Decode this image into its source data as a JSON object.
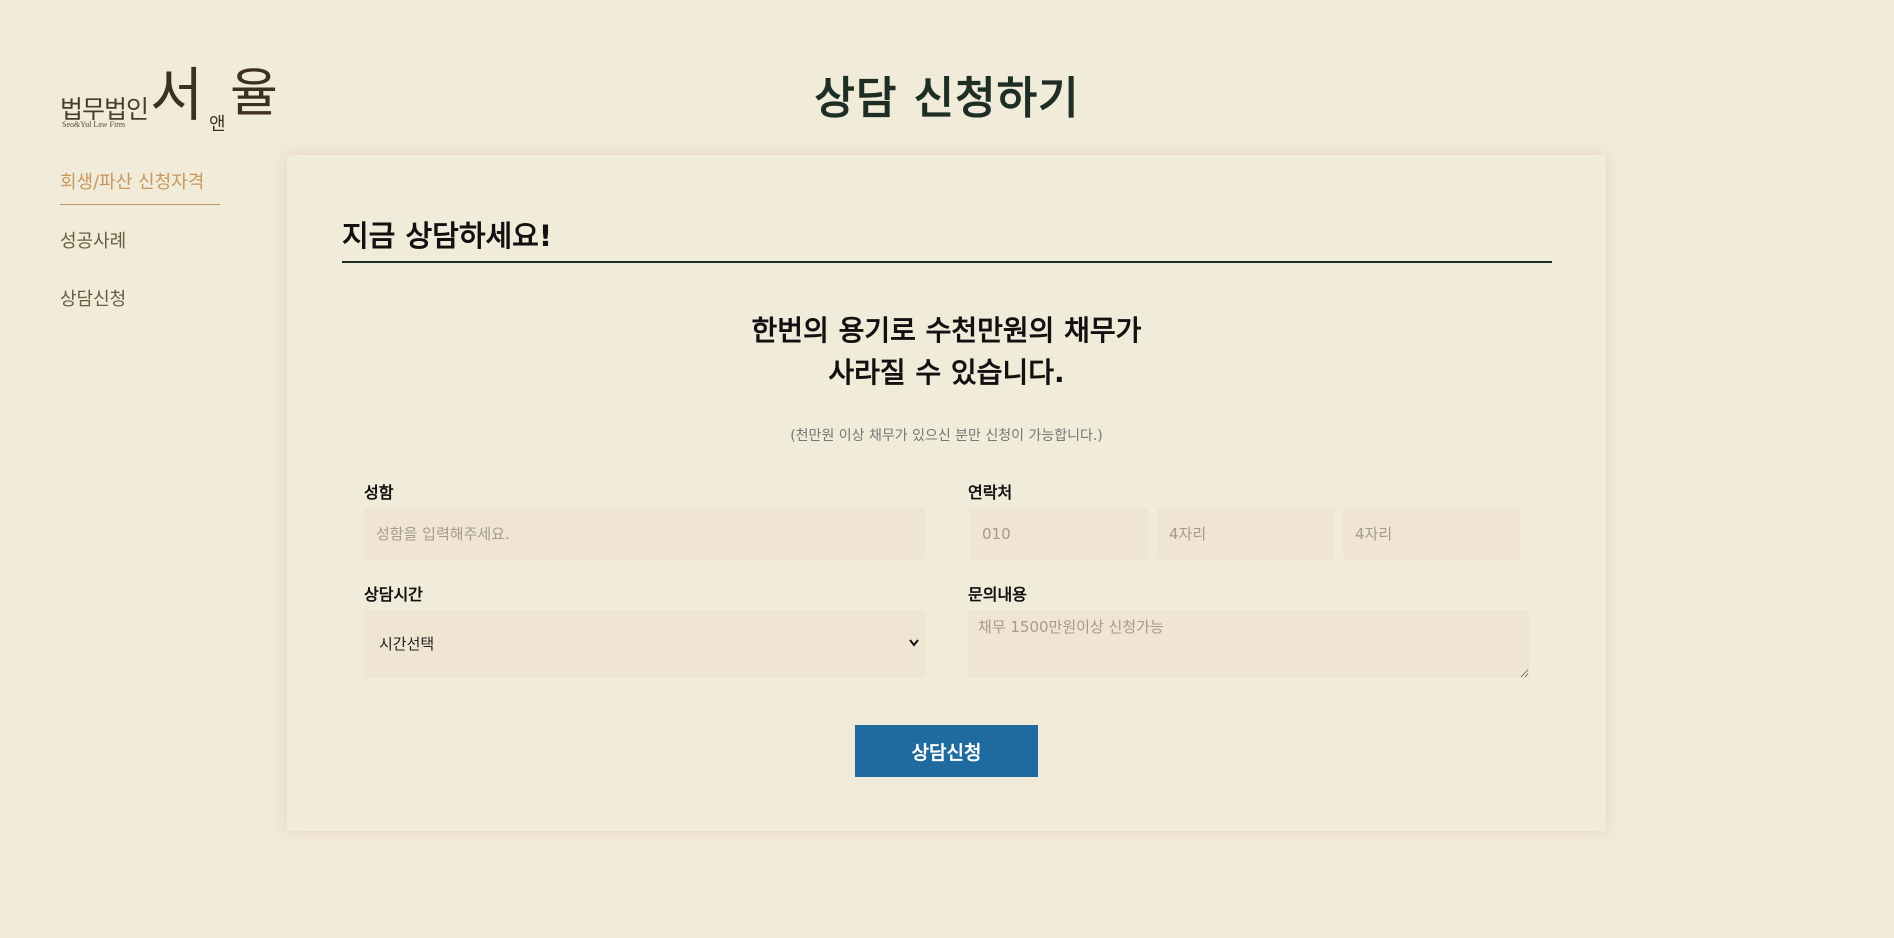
{
  "logo": {
    "firm_ko": "법무법인",
    "firm_en": "Seo&Yul Law Firm",
    "name_part1": "서",
    "name_connector": "앤",
    "name_part2": "율"
  },
  "sidenav": {
    "items": [
      {
        "label": "회생/파산 신청자격",
        "active": true
      },
      {
        "label": "성공사례",
        "active": false
      },
      {
        "label": "상담신청",
        "active": false
      }
    ]
  },
  "page_title": "상담 신청하기",
  "card": {
    "heading": "지금 상담하세요!",
    "headline_line1": "한번의 용기로 수천만원의 채무가",
    "headline_line2": "사라질 수 있습니다.",
    "notice": "(천만원 이상 채무가 있으신 분만 신청이 가능합니다.)"
  },
  "form": {
    "name_label": "성함",
    "name_placeholder": "성함을 입력해주세요.",
    "phone_label": "연락처",
    "phone1_placeholder": "010",
    "phone2_placeholder": "4자리",
    "phone3_placeholder": "4자리",
    "time_label": "상담시간",
    "time_selected": "시간선택",
    "message_label": "문의내용",
    "message_placeholder": "채무 1500만원이상 신청가능",
    "submit_label": "상담신청"
  },
  "colors": {
    "background": "#f1ebd9",
    "accent_gold": "#c9975c",
    "button_blue": "#1f6b9f",
    "input_bg": "#f0e5d2"
  }
}
